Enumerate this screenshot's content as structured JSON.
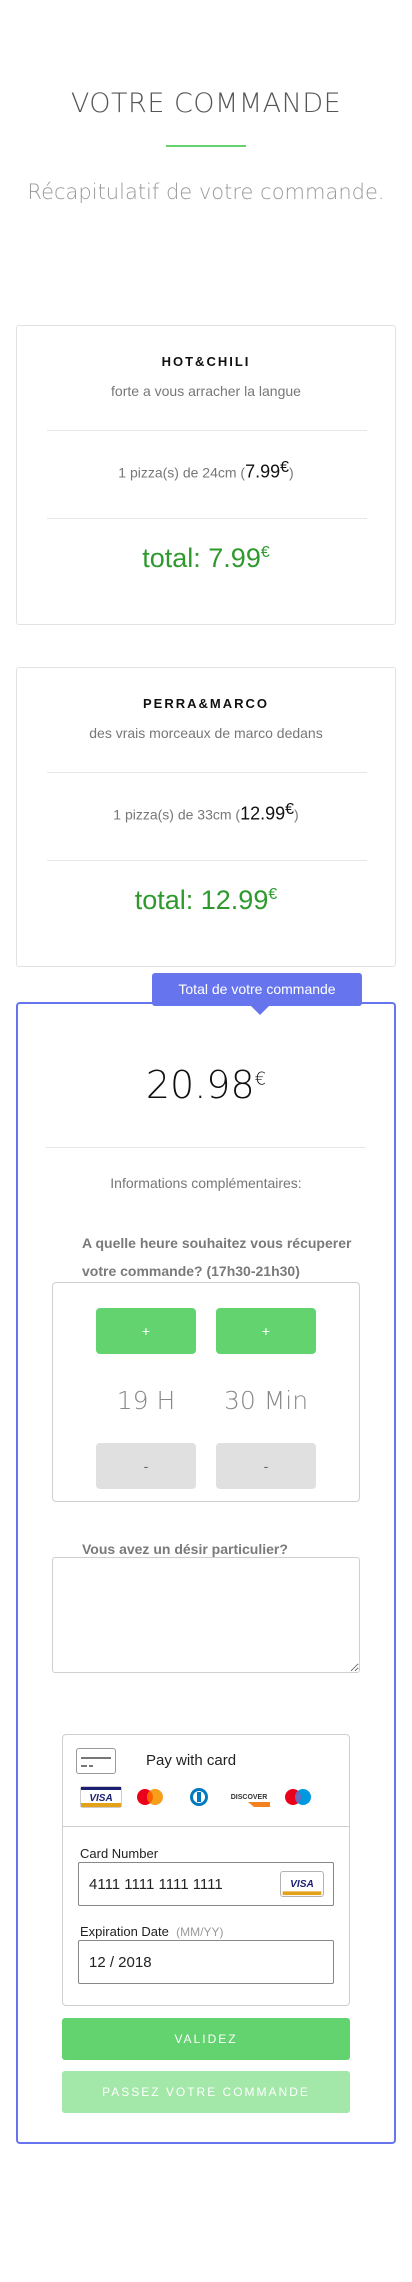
{
  "header": {
    "title": "VOTRE COMMANDE",
    "subtitle": "Récapitulatif de votre commande."
  },
  "pizzas": [
    {
      "name": "HOT&CHILI",
      "description": "forte a vous arracher la langue",
      "line_prefix": "1 pizza(s) de 24cm (",
      "price": "7.99",
      "currency": "€",
      "line_suffix": ")",
      "total_label": "total: 7.99",
      "total_currency": "€"
    },
    {
      "name": "PERRA&MARCO",
      "description": "des vrais morceaux de marco dedans",
      "line_prefix": "1 pizza(s) de 33cm (",
      "price": "12.99",
      "currency": "€",
      "line_suffix": ")",
      "total_label": "total: 12.99",
      "total_currency": "€"
    }
  ],
  "order": {
    "tab_label": "Total de votre commande",
    "total": "20.98",
    "currency": "€",
    "info_label": "Informations complémentaires:",
    "time_question": "A quelle heure souhaitez vous récuperer votre commande? (17h30-21h30)",
    "plus_label": "+",
    "minus_label": "-",
    "hour_value": "19 H",
    "minute_value": "30 Min",
    "wish_question": "Vous avez un désir particulier?",
    "wish_value": ""
  },
  "payment": {
    "title": "Pay with card",
    "brands": [
      "visa",
      "mastercard",
      "diners",
      "discover",
      "maestro"
    ],
    "brand_visa_text": "VISA",
    "brand_discover_text": "DISCOVER",
    "card_number_label": "Card Number",
    "card_number_value": "4111 1111 1111 1111",
    "expiry_label": "Expiration Date",
    "expiry_hint": "(MM/YY)",
    "expiry_value": "12 / 2018"
  },
  "actions": {
    "validate_label": "VALIDEZ",
    "submit_label": "PASSEZ VOTRE COMMANDE"
  },
  "colors": {
    "accent_green": "#62d36e",
    "total_green": "#2e9a2e",
    "order_blue": "#6675ee"
  }
}
